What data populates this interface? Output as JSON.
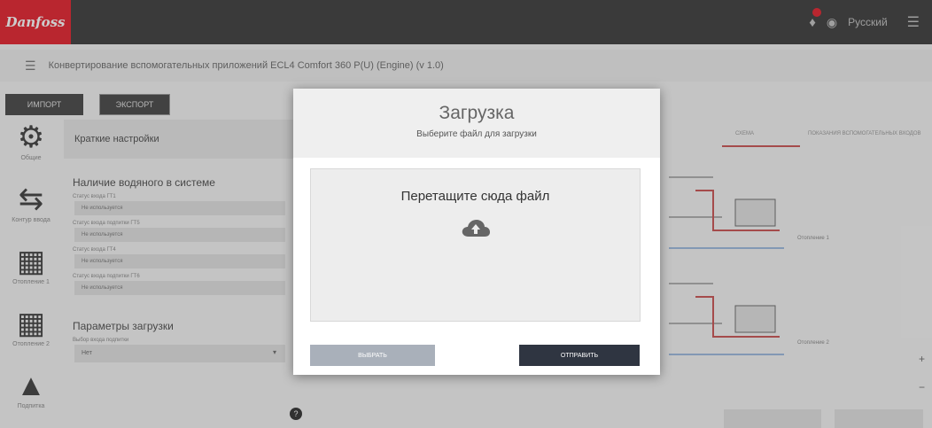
{
  "header": {
    "logo": "Danfoss",
    "language": "Русский"
  },
  "breadcrumb": {
    "text": "Конвертирование вспомогательных приложений ECL4 Comfort 360 P(U) (Engine) (v 1.0)"
  },
  "toolbar": {
    "import_label": "ИМПОРТ",
    "export_label": "ЭКСПОРТ"
  },
  "sidebar": {
    "items": [
      {
        "label": "Общие",
        "icon": "gear-icon"
      },
      {
        "label": "Контур ввода",
        "icon": "arrows-icon"
      },
      {
        "label": "Отопление 1",
        "icon": "radiator-icon"
      },
      {
        "label": "Отопление 2",
        "icon": "radiator-icon"
      },
      {
        "label": "Подпитка",
        "icon": "tank-icon"
      }
    ]
  },
  "panel": {
    "title": "Краткие настройки",
    "section1": "Наличие водяного в системе",
    "fields": [
      {
        "label": "Статус входа ГТ1",
        "value": "Не используется"
      },
      {
        "label": "Статус входа подпитки ГТ5",
        "value": "Не используется"
      },
      {
        "label": "Статус входа ГТ4",
        "value": "Не используется"
      },
      {
        "label": "Статус входа подпитки ГТ6",
        "value": "Не используется"
      }
    ],
    "section2": "Параметры загрузки",
    "select_label": "Выбор входа подпитки",
    "select_value": "Нет"
  },
  "right": {
    "tab_schema": "СХЕМА",
    "tab_alt": "ПОКАЗАНИЯ ВСПОМОГАТЕЛЬНЫХ ВХОДОВ",
    "label1": "Отопление 1",
    "label2": "Отопление 2"
  },
  "modal": {
    "title": "Загрузка",
    "subtitle": "Выберите файл для загрузки",
    "drop_text": "Перетащите сюда файл",
    "choose_label": "ВЫБРАТЬ",
    "send_label": "ОТПРАВИТЬ"
  },
  "colors": {
    "brand_red": "#e2000f",
    "topbar": "#1f1f1f",
    "send_button": "#2f3541",
    "choose_button": "#a9b0ba"
  }
}
